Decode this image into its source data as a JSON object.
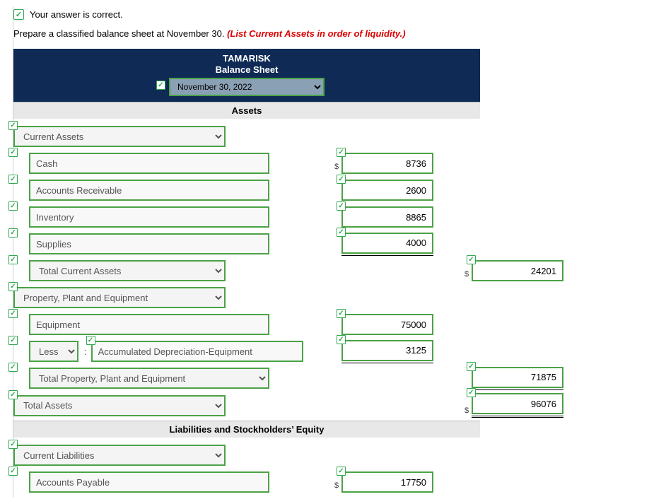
{
  "feedback": "Your answer is correct.",
  "instruction_plain": "Prepare a classified balance sheet at November 30. ",
  "instruction_red": "(List Current Assets in order of liquidity.)",
  "header": {
    "company": "TAMARISK",
    "title": "Balance Sheet",
    "date": "November 30, 2022"
  },
  "sections": {
    "assets": "Assets",
    "liab_eq": "Liabilities and Stockholders’ Equity"
  },
  "rows": {
    "cur_assets": "Current Assets",
    "cash": "Cash",
    "cash_v": "8736",
    "ar": "Accounts Receivable",
    "ar_v": "2600",
    "inv": "Inventory",
    "inv_v": "8865",
    "sup": "Supplies",
    "sup_v": "4000",
    "tca": "Total Current Assets",
    "tca_v": "24201",
    "ppe": "Property, Plant and Equipment",
    "equip": "Equipment",
    "equip_v": "75000",
    "less": "Less",
    "adep": "Accumulated Depreciation-Equipment",
    "adep_v": "3125",
    "tppe": "Total Property, Plant and Equipment",
    "tppe_v": "71875",
    "ta": "Total Assets",
    "ta_v": "96076",
    "cl": "Current Liabilities",
    "ap": "Accounts Payable",
    "ap_v": "17750"
  }
}
